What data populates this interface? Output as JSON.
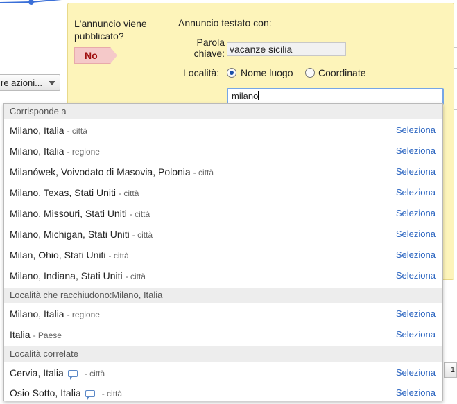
{
  "background": {
    "actions_label": "re azioni..."
  },
  "popup": {
    "published_question": "L'annuncio viene pubblicato?",
    "published_answer": "No",
    "tested_with": "Annuncio testato con:",
    "keyword_label": "Parola chiave:",
    "keyword_value": "vacanze sicilia",
    "location_label": "Località:",
    "radio_place_label": "Nome luogo",
    "radio_coords_label": "Coordinate",
    "radio_selected": "Nome luogo",
    "search_value": "milano"
  },
  "dropdown": {
    "section_matches": "Corrisponde a",
    "section_containing": "Località che racchiudono:Milano, Italia",
    "section_related": "Località correlate",
    "select_label": "Seleziona",
    "matches": [
      {
        "name": "Milano, Italia",
        "type": "- città"
      },
      {
        "name": "Milano, Italia",
        "type": "- regione"
      },
      {
        "name": "Milanówek, Voivodato di Masovia, Polonia",
        "type": "- città"
      },
      {
        "name": "Milano, Texas, Stati Uniti",
        "type": "- città"
      },
      {
        "name": "Milano, Missouri, Stati Uniti",
        "type": "- città"
      },
      {
        "name": "Milano, Michigan, Stati Uniti",
        "type": "- città"
      },
      {
        "name": "Milan, Ohio, Stati Uniti",
        "type": "- città"
      },
      {
        "name": "Milano, Indiana, Stati Uniti",
        "type": "- città"
      }
    ],
    "containing": [
      {
        "name": "Milano, Italia",
        "type": "- regione"
      },
      {
        "name": "Italia",
        "type": "- Paese"
      }
    ],
    "related": [
      {
        "name": "Cervia, Italia",
        "type": "- città",
        "icon": "comment-icon"
      },
      {
        "name": "Osio Sotto, Italia",
        "type": "- città",
        "icon": "comment-icon"
      }
    ]
  },
  "colors": {
    "popup_bg": "#fdf4ba",
    "link": "#2a64c0",
    "no_flag_bg": "#f5c9c9",
    "no_flag_text": "#a01010",
    "focus_border": "#76a6e6"
  }
}
